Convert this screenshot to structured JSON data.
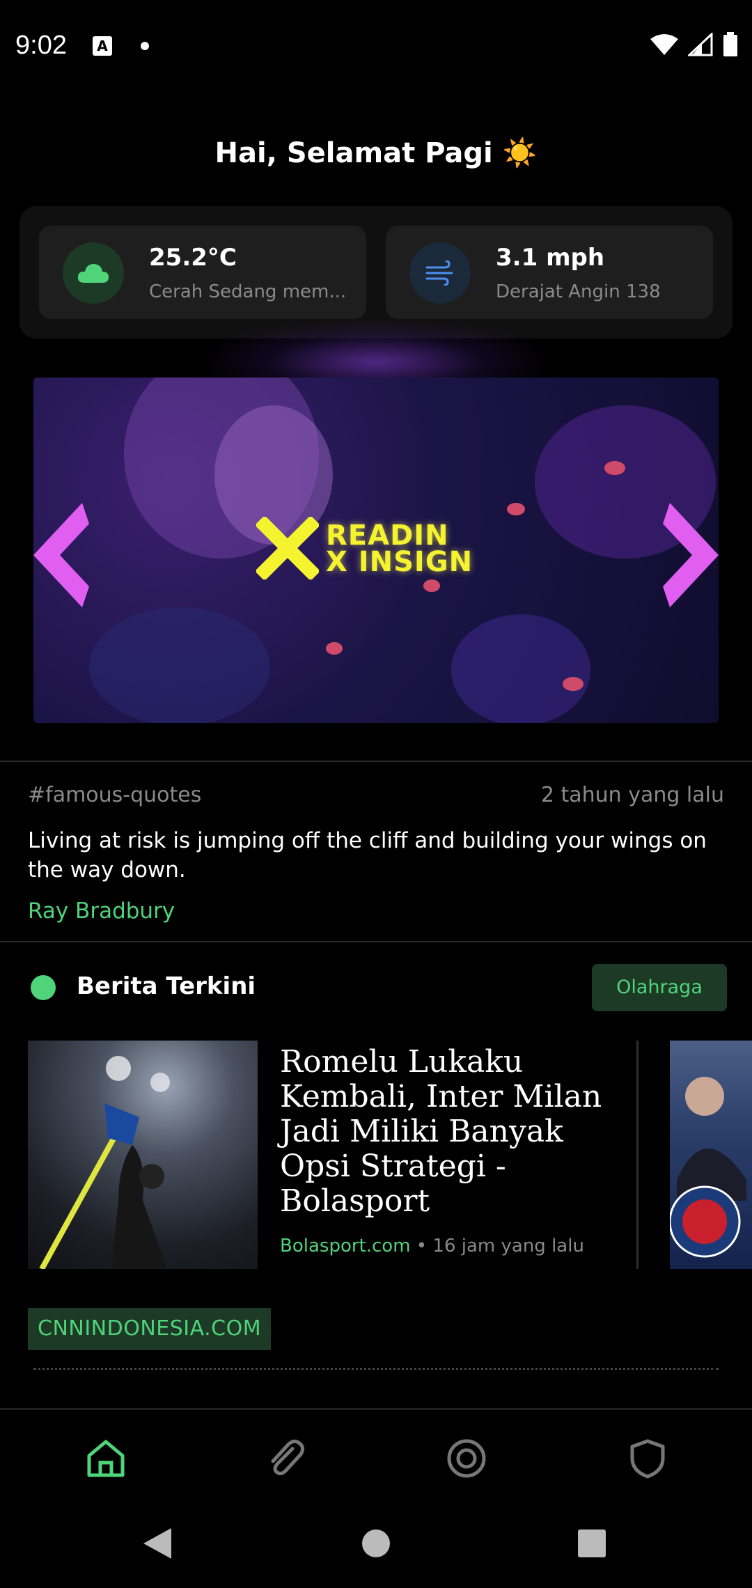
{
  "status": {
    "time": "9:02"
  },
  "greeting": "Hai, Selamat Pagi ☀️",
  "weather": {
    "temp": "25.2°C",
    "condition": "Cerah Sedang mem...",
    "wind": "3.1 mph",
    "wind_sub": "Derajat Angin 138"
  },
  "banner": {
    "line1": "READIN",
    "line2": "X INSIGN"
  },
  "quote": {
    "tag": "#famous-quotes",
    "time": "2 tahun yang lalu",
    "text": "Living at risk is jumping off the cliff and building your wings on the way down.",
    "author": "Ray Bradbury"
  },
  "news": {
    "section_title": "Berita Terkini",
    "category": "Olahraga",
    "headline": "Romelu Lukaku Kembali, Inter Milan Jadi Miliki Banyak Opsi Strategi - Bolasport",
    "source": "Bolasport.com",
    "meta_time": " • 16 jam yang lalu",
    "next_source_chip": "CNNINDONESIA.COM"
  },
  "colors": {
    "accent": "#4fd47a",
    "chip_bg": "#1d3a26",
    "banner_text": "#f5f230"
  },
  "bottom_nav": [
    "home-icon",
    "paperclip-icon",
    "target-icon",
    "shield-icon"
  ]
}
